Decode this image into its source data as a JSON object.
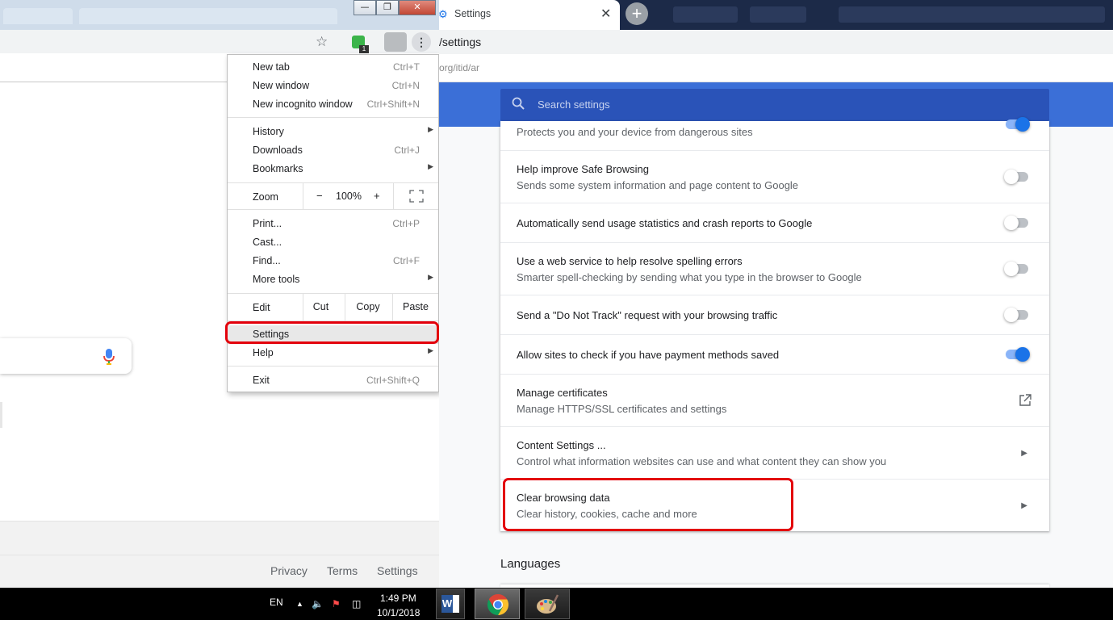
{
  "left_window": {
    "footer_links": [
      "Privacy",
      "Terms",
      "Settings"
    ]
  },
  "ext_badge": "1",
  "chrome_menu": {
    "group1": [
      {
        "label": "New tab",
        "shortcut": "Ctrl+T"
      },
      {
        "label": "New window",
        "shortcut": "Ctrl+N"
      },
      {
        "label": "New incognito window",
        "shortcut": "Ctrl+Shift+N"
      }
    ],
    "group2": [
      {
        "label": "History",
        "shortcut": ""
      },
      {
        "label": "Downloads",
        "shortcut": "Ctrl+J"
      },
      {
        "label": "Bookmarks",
        "shortcut": ""
      }
    ],
    "zoom": {
      "label": "Zoom",
      "minus": "−",
      "value": "100%",
      "plus": "+"
    },
    "group3": [
      {
        "label": "Print...",
        "shortcut": "Ctrl+P"
      },
      {
        "label": "Cast...",
        "shortcut": ""
      },
      {
        "label": "Find...",
        "shortcut": "Ctrl+F"
      },
      {
        "label": "More tools",
        "shortcut": ""
      }
    ],
    "edit": {
      "label": "Edit",
      "cut": "Cut",
      "copy": "Copy",
      "paste": "Paste"
    },
    "settings": "Settings",
    "help": "Help",
    "exit": {
      "label": "Exit",
      "shortcut": "Ctrl+Shift+Q"
    }
  },
  "right_window": {
    "tab_title": "Settings",
    "url": "/settings",
    "bookmark_text": "org/itid/ar",
    "search_placeholder": "Search settings",
    "rows": [
      {
        "title": "",
        "subtitle": "Protects you and your device from dangerous sites",
        "toggle": "on"
      },
      {
        "title": "Help improve Safe Browsing",
        "subtitle": "Sends some system information and page content to Google",
        "toggle": "off"
      },
      {
        "title": "Automatically send usage statistics and crash reports to Google",
        "subtitle": "",
        "toggle": "off"
      },
      {
        "title": "Use a web service to help resolve spelling errors",
        "subtitle": "Smarter spell-checking by sending what you type in the browser to Google",
        "toggle": "off"
      },
      {
        "title": "Send a \"Do Not Track\" request with your browsing traffic",
        "subtitle": "",
        "toggle": "off"
      },
      {
        "title": "Allow sites to check if you have payment methods saved",
        "subtitle": "",
        "toggle": "on"
      },
      {
        "title": "Manage certificates",
        "subtitle": "Manage HTTPS/SSL certificates and settings",
        "toggle": "external"
      },
      {
        "title": "Content Settings ...",
        "subtitle": "Control what information websites can use and what content they can show you",
        "toggle": "arrow"
      },
      {
        "title": "Clear browsing data",
        "subtitle": "Clear history, cookies, cache and more",
        "toggle": "arrow"
      }
    ],
    "languages_heading": "Languages"
  },
  "taskbar": {
    "language": "EN",
    "time": "1:49 PM",
    "date": "10/1/2018"
  },
  "colors": {
    "settings_blue": "#3b6fd7",
    "toggle_on": "#1a73e8",
    "highlight_red": "#e3000b"
  }
}
